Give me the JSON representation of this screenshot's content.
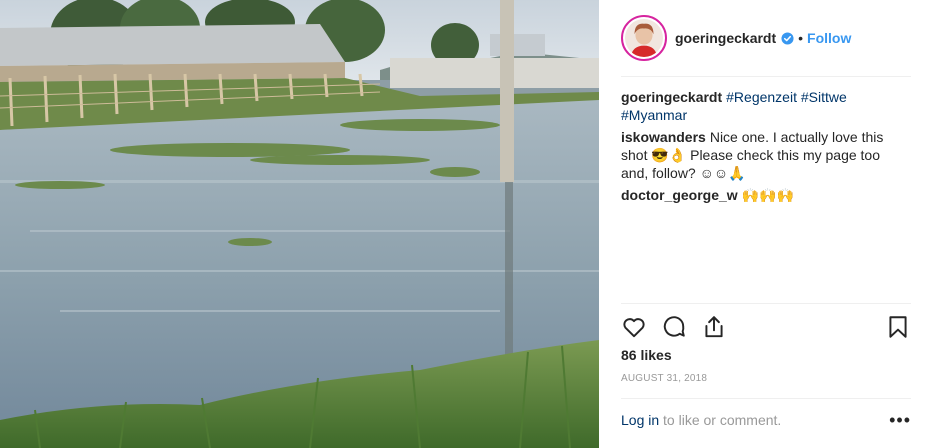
{
  "post": {
    "image_alt": "",
    "header": {
      "username": "goeringeckardt",
      "verified_icon": "verified-badge-icon",
      "separator": "•",
      "follow_label": "Follow"
    },
    "comments": [
      {
        "user": "goeringeckardt",
        "tags": [
          "#Regenzeit",
          "#Sittwe",
          "#Myanmar"
        ]
      },
      {
        "user": "iskowanders",
        "text": "Nice one. I actually love this shot 😎👌 Please check this my page too and, follow? ☺☺🙏"
      },
      {
        "user": "doctor_george_w",
        "text": "🙌🙌🙌"
      }
    ],
    "actions": {
      "like_icon": "heart-icon",
      "comment_icon": "comment-icon",
      "share_icon": "share-icon",
      "save_icon": "bookmark-icon"
    },
    "likes": "86 likes",
    "date": "AUGUST 31, 2018",
    "login": {
      "link": "Log in",
      "rest": "to like or comment."
    },
    "more_label": "•••",
    "colors": {
      "link_blue": "#3897f0",
      "hashtag": "#003569",
      "muted": "#999999",
      "text": "#262626"
    }
  }
}
